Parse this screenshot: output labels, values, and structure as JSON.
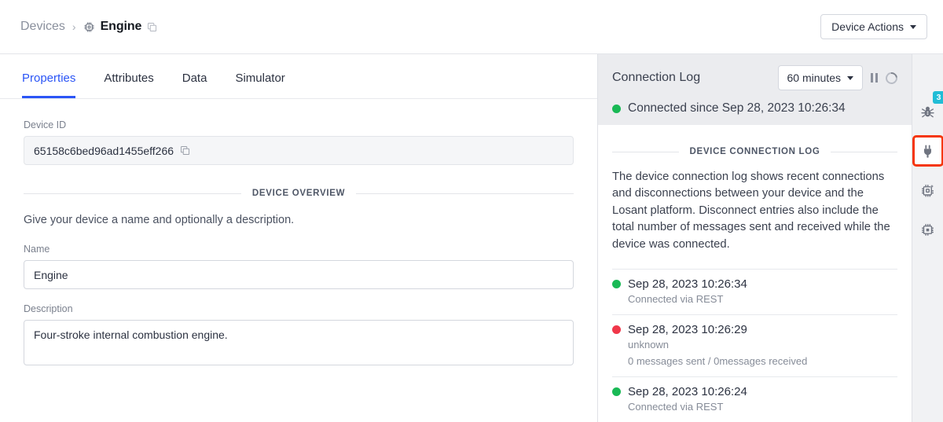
{
  "breadcrumb": {
    "root_label": "Devices",
    "separator": "›",
    "device_icon": "chip-icon",
    "current_label": "Engine",
    "copy_icon": "copy-icon"
  },
  "header": {
    "device_actions_label": "Device Actions"
  },
  "tabs": [
    {
      "label": "Properties",
      "active": true
    },
    {
      "label": "Attributes",
      "active": false
    },
    {
      "label": "Data",
      "active": false
    },
    {
      "label": "Simulator",
      "active": false
    }
  ],
  "form": {
    "device_id_label": "Device ID",
    "device_id_value": "65158c6bed96ad1455eff266",
    "device_id_copy_icon": "copy-icon",
    "overview_divider": "DEVICE OVERVIEW",
    "overview_help": "Give your device a name and optionally a description.",
    "name_label": "Name",
    "name_value": "Engine",
    "name_placeholder": "Name",
    "description_label": "Description",
    "description_value": "Four-stroke internal combustion engine.",
    "description_placeholder": "Description"
  },
  "connection_log": {
    "title": "Connection Log",
    "range_value": "60 minutes",
    "pause_icon": "pause-icon",
    "refresh_icon": "spinner-icon",
    "status_text": "Connected since Sep 28, 2023 10:26:34",
    "status_color": "#19b955",
    "divider": "DEVICE CONNECTION LOG",
    "description": "The device connection log shows recent connections and disconnections between your device and the Losant platform. Disconnect entries also include the total number of messages sent and received while the device was connected.",
    "entries": [
      {
        "state": "green",
        "timestamp": "Sep 28, 2023 10:26:34",
        "detail": "Connected via REST",
        "detail2": ""
      },
      {
        "state": "red",
        "timestamp": "Sep 28, 2023 10:26:29",
        "detail": "unknown",
        "detail2": "0 messages sent / 0messages received"
      },
      {
        "state": "green",
        "timestamp": "Sep 28, 2023 10:26:24",
        "detail": "Connected via REST",
        "detail2": ""
      }
    ]
  },
  "rail": {
    "items": [
      {
        "icon": "bug-icon",
        "badge": "3",
        "highlighted": false
      },
      {
        "icon": "plug-icon",
        "badge": "",
        "highlighted": true
      },
      {
        "icon": "chip-activity-icon",
        "badge": "",
        "highlighted": false
      },
      {
        "icon": "chip-data-icon",
        "badge": "",
        "highlighted": false
      }
    ],
    "badge_color": "#21bdd6",
    "highlight_color": "#f5360c"
  }
}
